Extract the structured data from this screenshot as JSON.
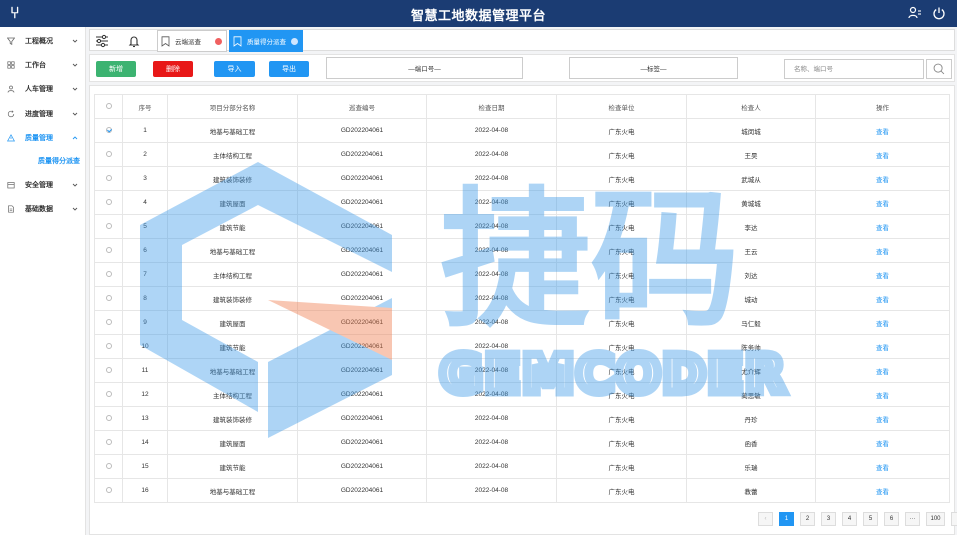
{
  "header": {
    "logo_glyph": "⑂",
    "title": "智慧工地数据管理平台",
    "icons": [
      "user-settings-icon",
      "power-icon"
    ]
  },
  "sidebar": {
    "items": [
      {
        "label": "工程概况",
        "icon": "funnel-icon"
      },
      {
        "label": "工作台",
        "icon": "grid-icon"
      },
      {
        "label": "人车管理",
        "icon": "person-icon"
      },
      {
        "label": "进度管理",
        "icon": "refresh-icon"
      },
      {
        "label": "质量管理",
        "icon": "warning-icon",
        "active": true
      },
      {
        "label": "安全管理",
        "icon": "safe-box-icon"
      },
      {
        "label": "基础数据",
        "icon": "document-icon"
      }
    ],
    "sub_item": "质量得分派查"
  },
  "tabs": [
    {
      "label": "云端派查",
      "active": false
    },
    {
      "label": "质量得分派查",
      "active": true
    }
  ],
  "toolbar": {
    "add_label": "新增",
    "delete_label": "删除",
    "import_label": "导入",
    "export_label": "导出",
    "filter_port": "—端口号—",
    "filter_tag": "—标签—",
    "search_placeholder": "名称、端口号"
  },
  "table": {
    "headers": [
      "序号",
      "项目分部分名称",
      "巡查编号",
      "检查日期",
      "检查单位",
      "检查人",
      "操作"
    ],
    "rows": [
      [
        "1",
        "地基与基础工程",
        "GD202204061",
        "2022-04-08",
        "广东火电",
        "城闵城",
        "查看"
      ],
      [
        "2",
        "主体结构工程",
        "GD202204061",
        "2022-04-08",
        "广东火电",
        "王昊",
        "查看"
      ],
      [
        "3",
        "建筑装饰装修",
        "GD202204061",
        "2022-04-08",
        "广东火电",
        "武城从",
        "查看"
      ],
      [
        "4",
        "建筑屋面",
        "GD202204061",
        "2022-04-08",
        "广东火电",
        "黄城城",
        "查看"
      ],
      [
        "5",
        "建筑节能",
        "GD202204061",
        "2022-04-08",
        "广东火电",
        "李达",
        "查看"
      ],
      [
        "6",
        "地基与基础工程",
        "GD202204061",
        "2022-04-08",
        "广东火电",
        "王云",
        "查看"
      ],
      [
        "7",
        "主体结构工程",
        "GD202204061",
        "2022-04-08",
        "广东火电",
        "刘达",
        "查看"
      ],
      [
        "8",
        "建筑装饰装修",
        "GD202204061",
        "2022-04-08",
        "广东火电",
        "城动",
        "查看"
      ],
      [
        "9",
        "建筑屋面",
        "GD202204061",
        "2022-04-08",
        "广东火电",
        "马仁毅",
        "查看"
      ],
      [
        "10",
        "建筑节能",
        "GD202204061",
        "2022-04-08",
        "广东火电",
        "陈务帅",
        "查看"
      ],
      [
        "11",
        "地基与基础工程",
        "GD202204061",
        "2022-04-08",
        "广东火电",
        "尤介辉",
        "查看"
      ],
      [
        "12",
        "主体结构工程",
        "GD202204061",
        "2022-04-08",
        "广东火电",
        "蔺思敏",
        "查看"
      ],
      [
        "13",
        "建筑装饰装修",
        "GD202204061",
        "2022-04-08",
        "广东火电",
        "丹珍",
        "查看"
      ],
      [
        "14",
        "建筑屋面",
        "GD202204061",
        "2022-04-08",
        "广东火电",
        "函香",
        "查看"
      ],
      [
        "15",
        "建筑节能",
        "GD202204061",
        "2022-04-08",
        "广东火电",
        "乐瑞",
        "查看"
      ],
      [
        "16",
        "地基与基础工程",
        "GD202204061",
        "2022-04-08",
        "广东火电",
        "教蕾",
        "查看"
      ]
    ],
    "checked_rows": [
      0
    ]
  },
  "pagination": {
    "prev": "‹",
    "pages": [
      "1",
      "2",
      "3",
      "4",
      "5",
      "6"
    ],
    "ellipsis": "···",
    "last": "100",
    "next": "›",
    "current": "1"
  },
  "watermark": {
    "brand": "捷码",
    "brand_en": "GEMCODER"
  },
  "colors": {
    "header_bg": "#1b3c73",
    "accent": "#2196f3",
    "add_btn": "#3cb371",
    "delete_btn": "#e81818"
  }
}
